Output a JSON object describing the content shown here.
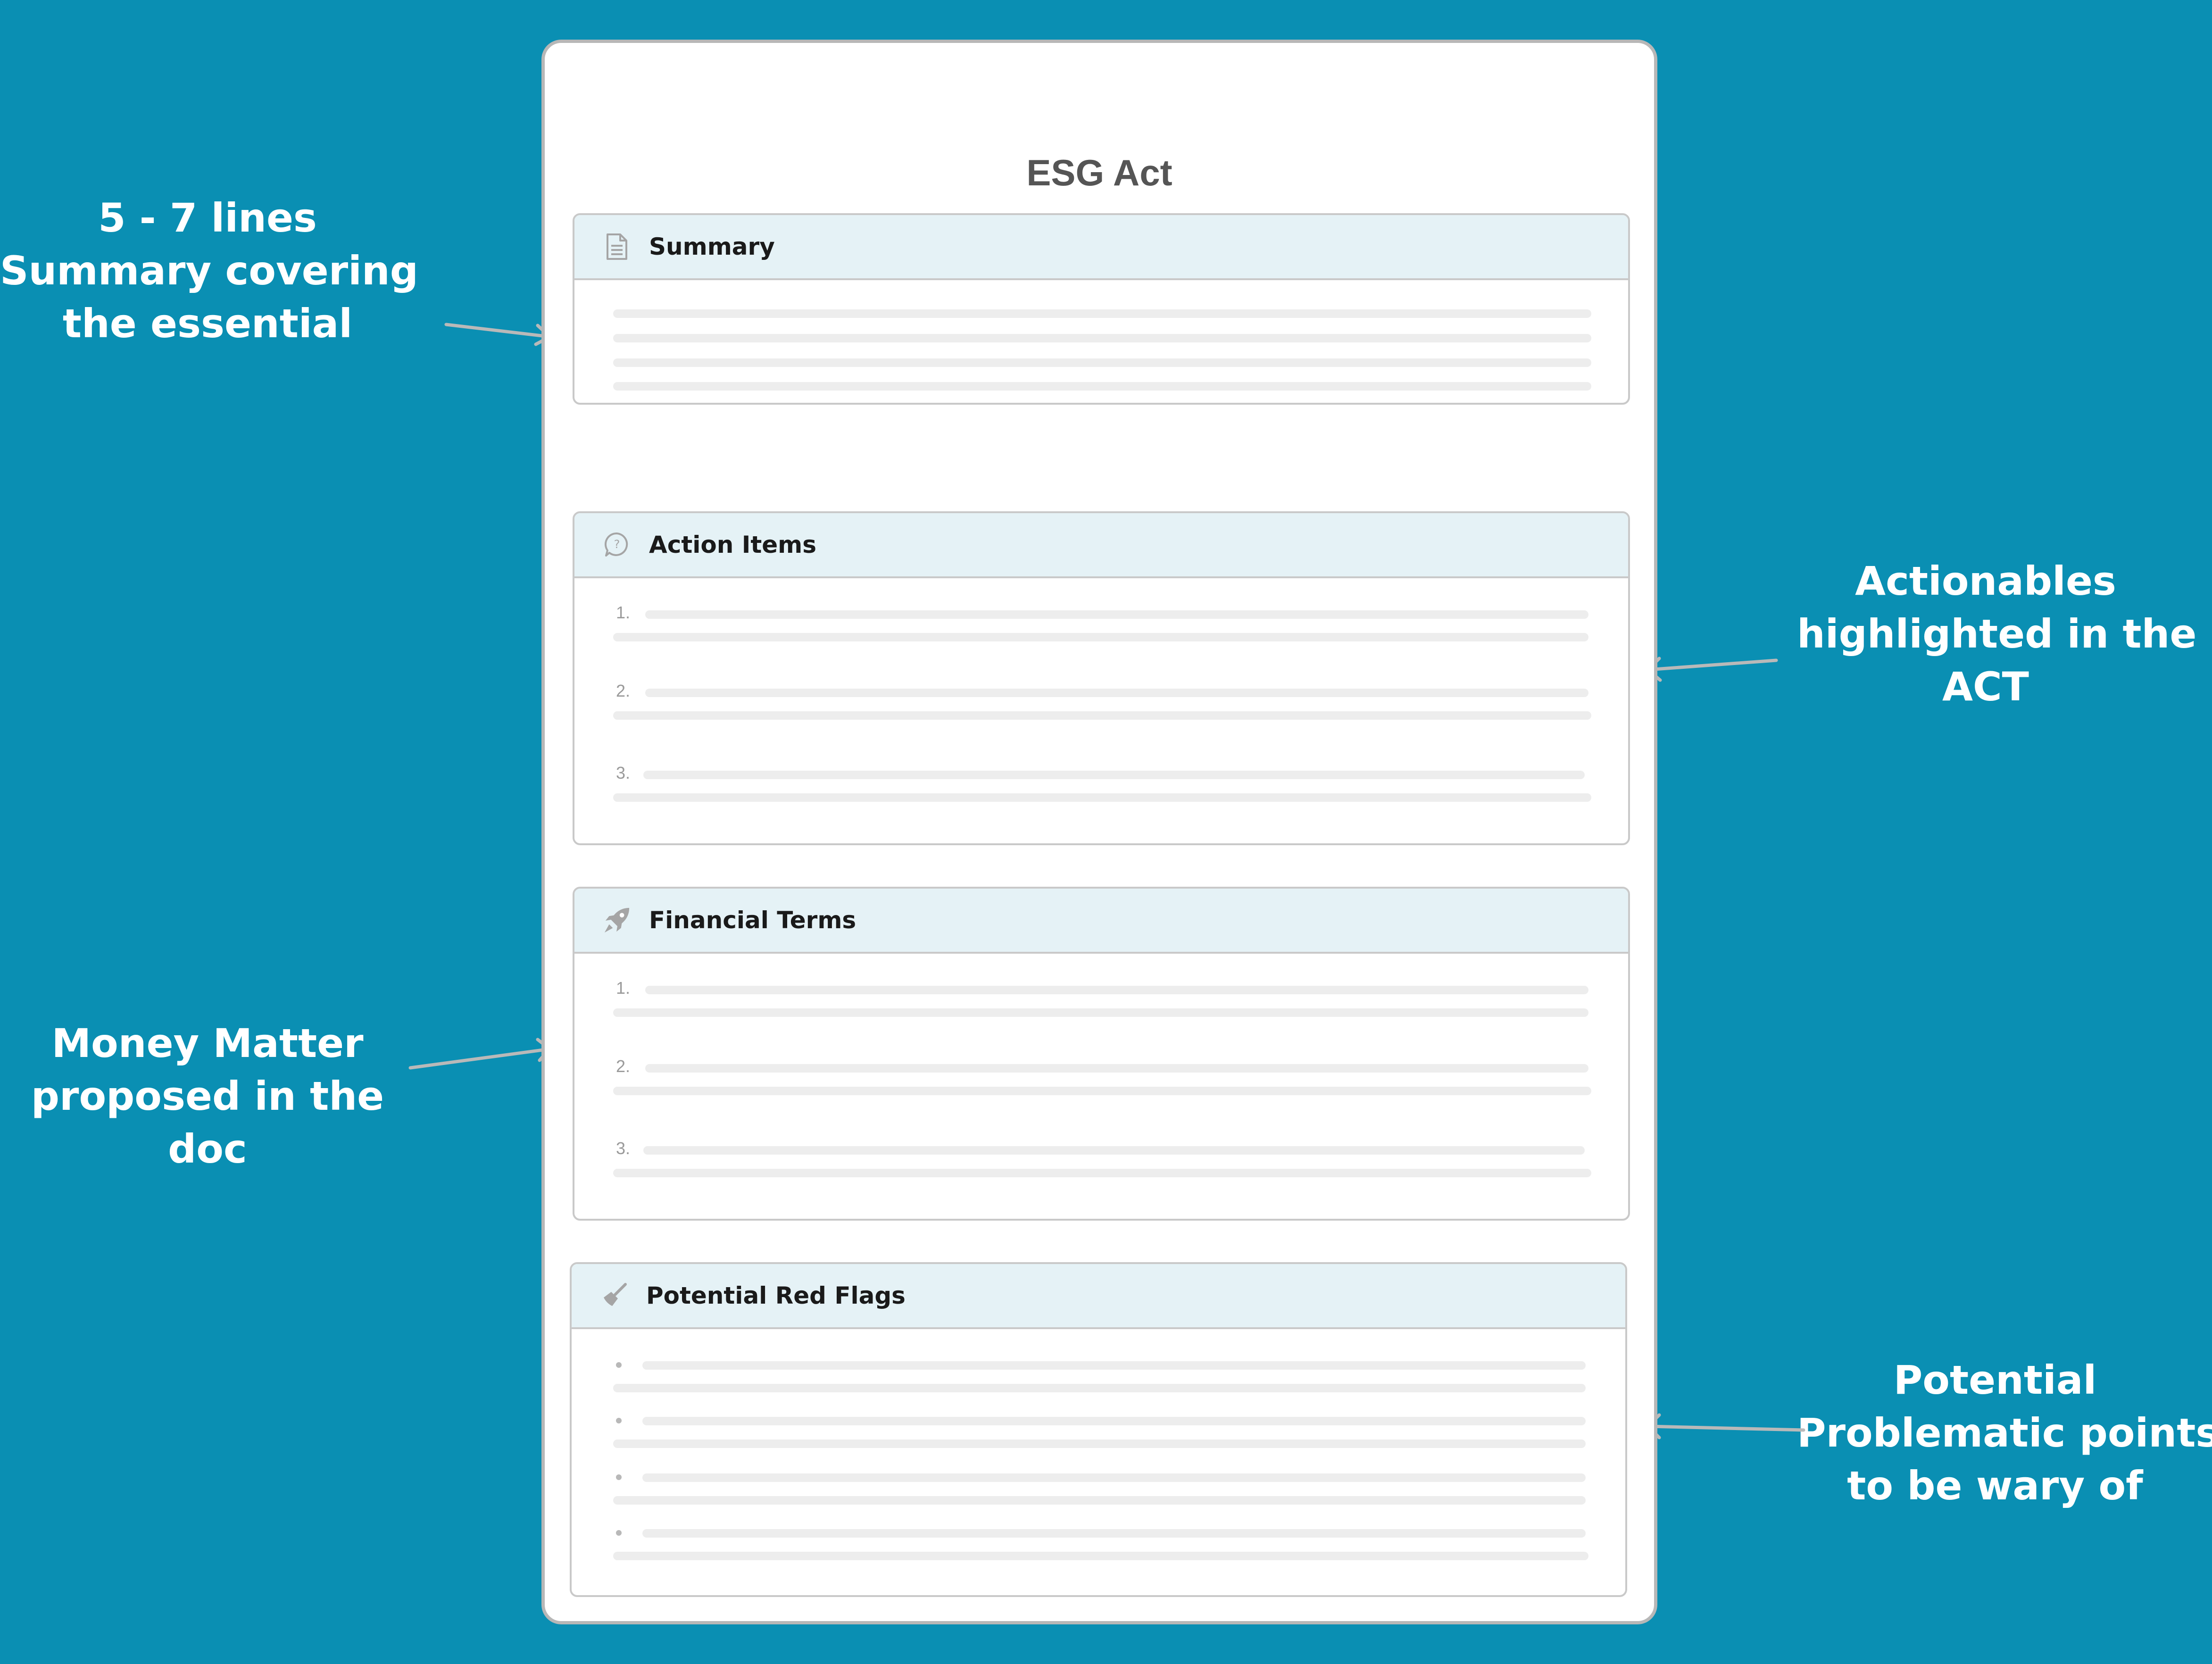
{
  "document": {
    "title": "ESG Act",
    "sections": [
      {
        "id": "summary",
        "title": "Summary",
        "icon": "document-icon",
        "list_style": "none"
      },
      {
        "id": "action-items",
        "title": "Action Items",
        "icon": "question-bubble-icon",
        "list_style": "numbered",
        "markers": [
          "1.",
          "2.",
          "3."
        ]
      },
      {
        "id": "financial-terms",
        "title": "Financial Terms",
        "icon": "rocket-icon",
        "list_style": "numbered",
        "markers": [
          "1.",
          "2.",
          "3."
        ]
      },
      {
        "id": "red-flags",
        "title": "Potential Red Flags",
        "icon": "broom-icon",
        "list_style": "bulleted"
      }
    ]
  },
  "annotations": {
    "summary": [
      "5 - 7 lines",
      "Summary covering",
      "the essential"
    ],
    "actions": [
      "Actionables",
      "highlighted in the",
      "ACT"
    ],
    "money": [
      "Money Matter",
      "proposed in the",
      "doc"
    ],
    "flags": [
      "Potential",
      "Problematic points",
      "to be wary of"
    ]
  },
  "colors": {
    "background": "#0a8fb3",
    "card_header": "#e5f2f6",
    "placeholder_line": "#ededed",
    "annotation_text": "#ffffff",
    "arrow": "#b9b9b9"
  }
}
